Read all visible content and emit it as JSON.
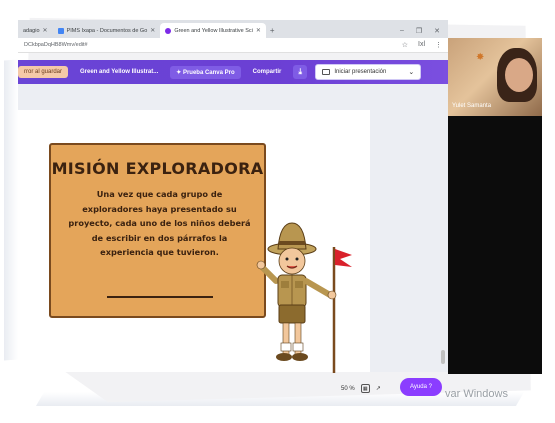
{
  "browser": {
    "tabs": [
      {
        "label": "adagio",
        "active": false
      },
      {
        "label": "PIMS Ixapa - Documentos de Go",
        "active": false
      },
      {
        "label": "Green and Yellow Illustrative Sci",
        "active": true
      }
    ],
    "new_tab": "+",
    "window_controls": [
      "–",
      "❐",
      "✕"
    ],
    "url": "DCkbpaDqHB8Wmv/edit#",
    "url_actions": [
      "☆",
      "Ixl",
      "⋮"
    ]
  },
  "canva": {
    "save_label": "rror al guardar",
    "design_title": "Green and Yellow Illustrat...",
    "pro_label": "✦ Prueba Canva Pro",
    "share_label": "Compartir",
    "download_icon": "download-icon",
    "present_label": "Iniciar presentación",
    "present_chevron": "⌄"
  },
  "slide": {
    "title": "MISIÓN EXPLORADORA",
    "body": "Una vez que cada grupo de exploradores haya presentado su proyecto, cada uno de los niños deberá de escribir en dos párrafos la experiencia que tuvieron."
  },
  "status": {
    "zoom": "50 %",
    "page_icon": "pages-icon",
    "expand_icon": "↗",
    "help_label": "Ayuda ?",
    "activate_text": "var Windows"
  },
  "video": {
    "participant_name": "Yulet Samanta"
  },
  "colors": {
    "canva_purple": "#6a45d6",
    "card_fill": "#e4a55a",
    "card_text": "#3b2210",
    "help_purple": "#8b3dff"
  }
}
